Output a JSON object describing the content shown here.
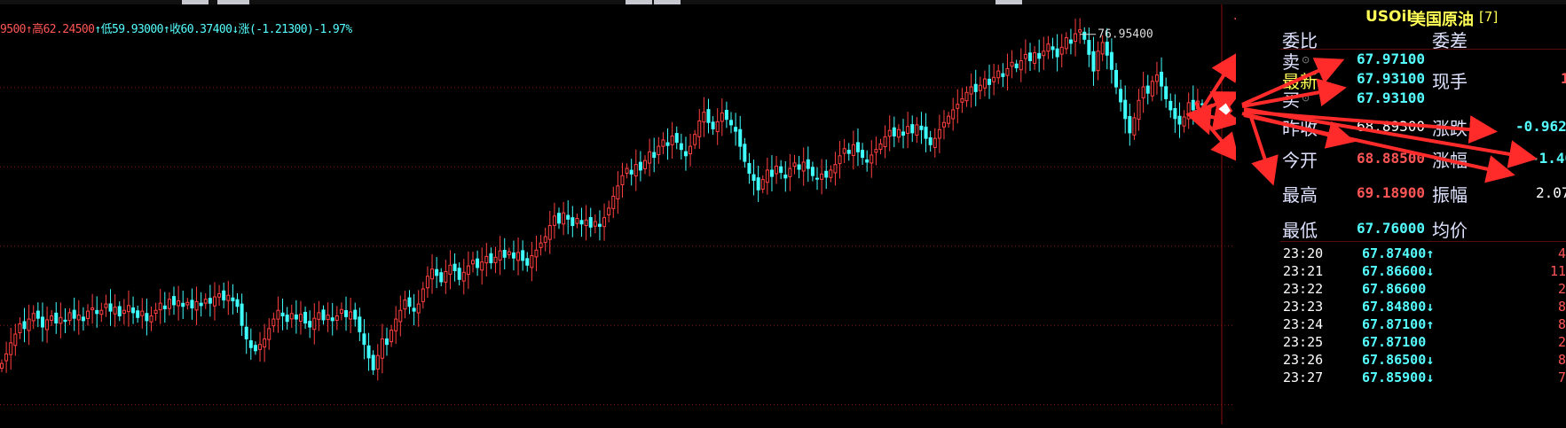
{
  "info_line": {
    "open_part": "9500",
    "high_label": "↑高",
    "high_value": "62.24500",
    "low_label": "↑低",
    "low_value": "59.93000",
    "close_label": "↑收",
    "close_value": "60.37400",
    "change_label": "↓涨",
    "change_value": "(-1.21300)-1.97%"
  },
  "chart_data": {
    "type": "candlestick",
    "title": "",
    "ylim": [
      27.5,
      80.5
    ],
    "y_ticks": [
      "70.00",
      "60.00",
      "50.00",
      "40.00",
      "30.00"
    ],
    "y_tick_values": [
      70,
      60,
      50,
      40,
      30
    ],
    "annotation": "76.95400",
    "annotation_value": 76.954,
    "colors": {
      "up": "#ff4040",
      "down": "#40ffff",
      "grid": "#8a1010",
      "drawing": "#ff2a2a"
    },
    "trend_lines": [
      {
        "from": [
          0.827,
          76.95
        ],
        "to": [
          0.943,
          69.0
        ]
      },
      {
        "from": [
          0.845,
          71.7
        ],
        "to": [
          0.943,
          68.6
        ]
      },
      {
        "from": [
          0.775,
          62.3
        ],
        "to": [
          0.943,
          62.3
        ]
      },
      {
        "from": [
          0.86,
          64.8
        ],
        "to": [
          0.943,
          66.2
        ]
      }
    ],
    "closes": [
      35.2,
      36.4,
      37.8,
      38.9,
      40.2,
      39.6,
      40.8,
      41.5,
      40.9,
      39.8,
      40.7,
      41.2,
      40.3,
      41.0,
      40.5,
      41.6,
      40.9,
      41.3,
      40.6,
      41.8,
      42.2,
      41.5,
      41.9,
      42.7,
      41.8,
      42.3,
      41.2,
      41.9,
      42.5,
      41.6,
      41.0,
      41.8,
      40.6,
      41.2,
      41.9,
      42.8,
      42.1,
      43.3,
      42.6,
      43.1,
      42.4,
      42.9,
      42.2,
      43.0,
      42.5,
      43.3,
      42.8,
      43.6,
      44.0,
      43.2,
      43.8,
      43.1,
      42.4,
      40.0,
      38.3,
      37.2,
      36.8,
      37.6,
      38.3,
      39.6,
      40.8,
      41.9,
      41.2,
      40.5,
      41.5,
      40.8,
      41.4,
      40.3,
      39.8,
      40.9,
      41.6,
      40.7,
      41.3,
      40.6,
      41.2,
      42.0,
      41.1,
      41.7,
      40.8,
      39.2,
      37.6,
      35.9,
      34.4,
      36.2,
      38.3,
      37.6,
      39.4,
      40.8,
      41.9,
      43.2,
      42.4,
      41.8,
      42.7,
      44.6,
      46.2,
      47.1,
      46.3,
      45.5,
      46.8,
      47.6,
      46.9,
      45.8,
      46.7,
      47.5,
      48.2,
      47.3,
      48.0,
      48.7,
      47.9,
      48.6,
      49.4,
      48.6,
      49.3,
      48.5,
      49.2,
      48.2,
      47.6,
      48.8,
      49.5,
      50.4,
      51.2,
      52.6,
      53.8,
      52.9,
      54.2,
      53.4,
      52.6,
      53.5,
      52.8,
      53.3,
      52.4,
      53.1,
      52.5,
      53.6,
      54.8,
      56.3,
      57.6,
      58.9,
      59.8,
      59.1,
      60.3,
      59.6,
      60.8,
      61.9,
      61.2,
      62.6,
      63.4,
      62.7,
      63.9,
      63.1,
      62.2,
      61.4,
      62.6,
      64.1,
      65.8,
      66.9,
      65.6,
      64.8,
      65.7,
      66.8,
      66.0,
      65.3,
      64.5,
      62.6,
      60.7,
      59.2,
      58.3,
      57.1,
      58.4,
      59.6,
      58.8,
      60.1,
      59.3,
      58.6,
      59.8,
      60.5,
      59.7,
      60.6,
      59.8,
      58.9,
      58.5,
      59.1,
      58.7,
      59.6,
      60.3,
      61.4,
      62.3,
      61.7,
      62.8,
      61.9,
      61.2,
      60.6,
      61.5,
      62.2,
      62.9,
      63.8,
      64.6,
      63.9,
      64.7,
      64.0,
      65.1,
      64.3,
      65.3,
      64.7,
      63.6,
      62.8,
      63.6,
      64.7,
      65.6,
      66.4,
      67.2,
      67.9,
      68.6,
      69.4,
      70.1,
      69.5,
      70.3,
      71.1,
      70.4,
      71.3,
      72.1,
      71.4,
      72.4,
      73.2,
      72.5,
      73.4,
      74.2,
      73.4,
      74.4,
      73.7,
      74.6,
      75.5,
      74.8,
      73.9,
      75.1,
      76.3,
      75.6,
      76.8,
      77.3,
      76.1,
      74.2,
      72.1,
      74.6,
      75.7,
      74.1,
      72.3,
      70.1,
      68.2,
      66.1,
      64.3,
      66.2,
      68.4,
      70.1,
      69.3,
      70.8,
      71.6,
      70.2,
      68.6,
      67.2,
      66.1,
      65.4,
      66.3,
      68.1,
      67.2,
      68.3,
      67.9
    ],
    "price_low": 27.5,
    "price_high": 80.5
  },
  "axis_label_color": "#ff5555",
  "right_icons": {
    "anchor_icon": "⚓",
    "box_icon": "⊡"
  },
  "panel": {
    "symbol_code": "USOil",
    "symbol_name": "美国原油",
    "symbol_tag": "[7]",
    "weibi_label": "委比",
    "weicha_label": "委差",
    "sell_label": "卖",
    "sell_value": "67.97100",
    "latest_label": "最新",
    "latest_value": "67.93100",
    "xianshou_label": "现手",
    "xianshou_value": "1",
    "buy_label": "买",
    "buy_value": "67.93100",
    "prevclose_label": "昨收",
    "prevclose_value": "68.89300",
    "change_label": "涨跌",
    "change_value": "-0.9620",
    "open_label": "今开",
    "open_value": "68.88500",
    "pct_label": "涨幅",
    "pct_value": "-1.40",
    "high_label": "最高",
    "high_value": "69.18900",
    "amplitude_label": "振幅",
    "amplitude_value": "2.07",
    "low_label": "最低",
    "low_value": "67.76000",
    "avg_label": "均价",
    "avg_value": ""
  },
  "ticks": [
    {
      "time": "23:20",
      "price": "67.87400↑",
      "vol": "4",
      "dir": "up"
    },
    {
      "time": "23:21",
      "price": "67.86600↓",
      "vol": "11",
      "dir": "down"
    },
    {
      "time": "23:22",
      "price": "67.86600",
      "vol": "2",
      "dir": "flat"
    },
    {
      "time": "23:23",
      "price": "67.84800↓",
      "vol": "8",
      "dir": "down"
    },
    {
      "time": "23:24",
      "price": "67.87100↑",
      "vol": "8",
      "dir": "up"
    },
    {
      "time": "23:25",
      "price": "67.87100",
      "vol": "2",
      "dir": "flat"
    },
    {
      "time": "23:26",
      "price": "67.86500↓",
      "vol": "8",
      "dir": "down"
    },
    {
      "time": "23:27",
      "price": "67.85900↓",
      "vol": "7",
      "dir": "down"
    }
  ]
}
